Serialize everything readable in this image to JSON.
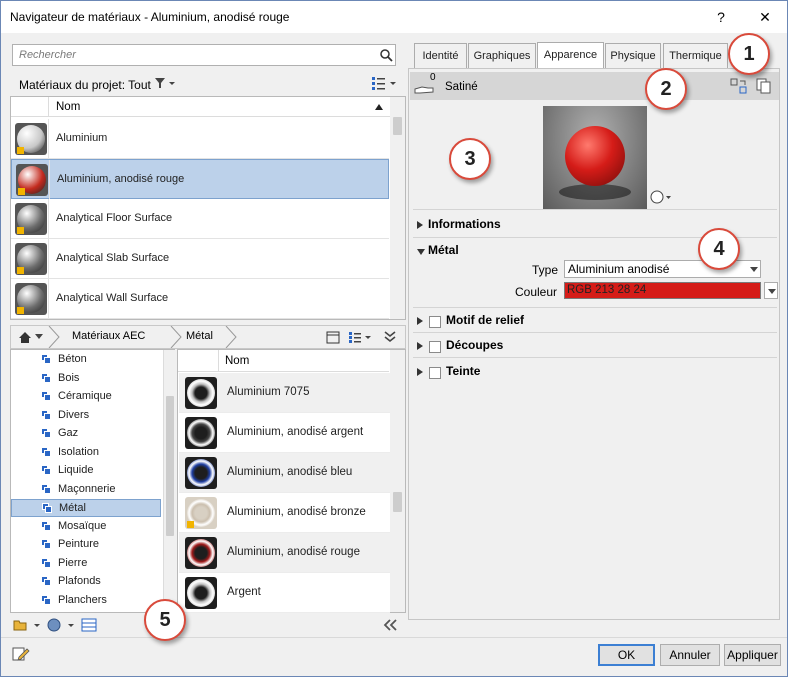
{
  "window": {
    "title": "Navigateur de matériaux - Aluminium, anodisé rouge",
    "help": "?",
    "close": "✕"
  },
  "search": {
    "placeholder": "Rechercher"
  },
  "project_materials": {
    "filter_label": "Matériaux du projet: Tout",
    "column_name": "Nom",
    "items": [
      {
        "label": "Aluminium",
        "color": "#c8c8c8"
      },
      {
        "label": "Aluminium, anodisé rouge",
        "color": "#c32a1e",
        "selected": true
      },
      {
        "label": "Analytical Floor Surface",
        "color": "#6d6d6d"
      },
      {
        "label": "Analytical Slab Surface",
        "color": "#6d6d6d"
      },
      {
        "label": "Analytical Wall Surface",
        "color": "#6d6d6d"
      }
    ]
  },
  "library": {
    "breadcrumb": [
      "Matériaux AEC",
      "Métal"
    ],
    "tree": [
      {
        "label": "Béton"
      },
      {
        "label": "Bois"
      },
      {
        "label": "Céramique"
      },
      {
        "label": "Divers"
      },
      {
        "label": "Gaz"
      },
      {
        "label": "Isolation"
      },
      {
        "label": "Liquide"
      },
      {
        "label": "Maçonnerie"
      },
      {
        "label": "Métal",
        "selected": true
      },
      {
        "label": "Mosaïque"
      },
      {
        "label": "Peinture"
      },
      {
        "label": "Pierre"
      },
      {
        "label": "Plafonds"
      },
      {
        "label": "Planchers"
      }
    ],
    "column_name": "Nom",
    "items": [
      {
        "label": "Aluminium 7075",
        "color": "#bdbdbd"
      },
      {
        "label": "Aluminium, anodisé argent",
        "color": "#444444"
      },
      {
        "label": "Aluminium, anodisé bleu",
        "color": "#1f3fa3"
      },
      {
        "label": "Aluminium, anodisé bronze",
        "color": "#cbbfae"
      },
      {
        "label": "Aluminium, anodisé rouge",
        "color": "#a11a1a"
      },
      {
        "label": "Argent",
        "color": "#c2c2c2"
      }
    ]
  },
  "tabs": [
    {
      "label": "Identité"
    },
    {
      "label": "Graphiques"
    },
    {
      "label": "Apparence",
      "active": true
    },
    {
      "label": "Physique"
    },
    {
      "label": "Thermique"
    }
  ],
  "appearance": {
    "usage_count": "0",
    "asset_name": "Satiné",
    "sections": {
      "informations": "Informations",
      "metal": "Métal",
      "relief": "Motif de relief",
      "cutouts": "Découpes",
      "tint": "Teinte"
    },
    "type_label": "Type",
    "type_value": "Aluminium anodisé",
    "color_label": "Couleur",
    "color_value": "RGB 213 28 24",
    "color_hex": "#d51c18"
  },
  "callouts": [
    "1",
    "2",
    "3",
    "4",
    "5"
  ],
  "buttons": {
    "ok": "OK",
    "cancel": "Annuler",
    "apply": "Appliquer"
  }
}
